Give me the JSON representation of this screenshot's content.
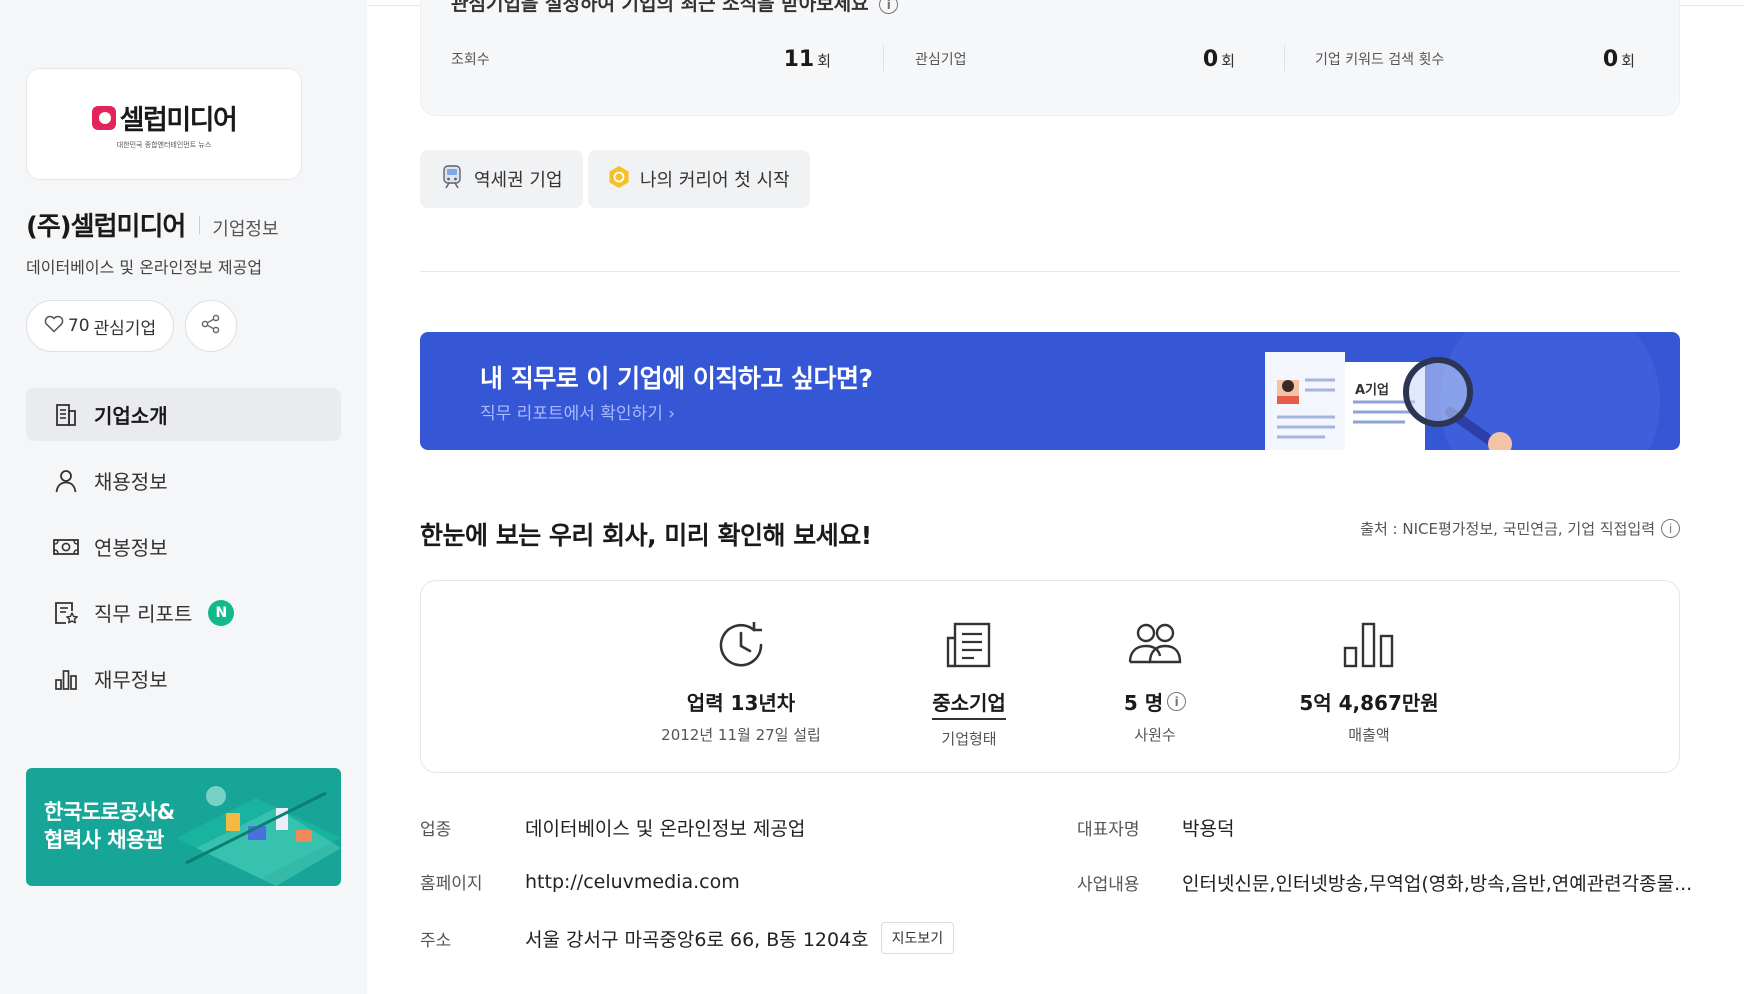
{
  "sidebar": {
    "logo": {
      "text": "셀럽미디어",
      "tagline": "대한민국 종합엔터테인먼트 뉴스"
    },
    "company_name": "(주)셀럽미디어",
    "company_tag": "기업정보",
    "industry": "데이터베이스 및 온라인정보 제공업",
    "favorite_count": "70",
    "favorite_label": "관심기업",
    "nav": [
      {
        "label": "기업소개",
        "icon": "building-icon",
        "active": true
      },
      {
        "label": "채용정보",
        "icon": "person-icon",
        "active": false
      },
      {
        "label": "연봉정보",
        "icon": "money-icon",
        "active": false
      },
      {
        "label": "직무 리포트",
        "icon": "report-icon",
        "active": false,
        "badge": "N"
      },
      {
        "label": "재무정보",
        "icon": "bar-chart-icon",
        "active": false
      }
    ],
    "promo": {
      "line1": "한국도로공사&",
      "line2": "협력사 채용관"
    }
  },
  "stats": {
    "title": "관심기업을 설정하여 기업의 최근 소식을 받아보세요",
    "items": [
      {
        "label": "조회수",
        "value": "11",
        "unit": "회"
      },
      {
        "label": "관심기업",
        "value": "0",
        "unit": "회"
      },
      {
        "label": "기업 키워드 검색 횟수",
        "value": "0",
        "unit": "회"
      }
    ]
  },
  "chips": [
    {
      "label": "역세권 기업",
      "icon": "train-icon"
    },
    {
      "label": "나의 커리어 첫 시작",
      "icon": "hexagon-badge-icon"
    }
  ],
  "banner": {
    "title": "내 직무로 이 기업에 이직하고 싶다면?",
    "link": "직무 리포트에서 확인하기",
    "doc_label": "A기업"
  },
  "summary": {
    "title": "한눈에 보는 우리 회사, 미리 확인해 보세요!",
    "source": "출처 : NICE평가정보, 국민연금, 기업 직접입력",
    "items": [
      {
        "value": "업력 13년차",
        "sub": "2012년 11월 27일 설립",
        "icon": "clock-icon"
      },
      {
        "value": "중소기업",
        "sub": "기업형태",
        "icon": "newspaper-icon"
      },
      {
        "value": "5 명",
        "sub": "사원수",
        "icon": "people-icon"
      },
      {
        "value": "5억 4,867만원",
        "sub": "매출액",
        "icon": "bar-chart-icon"
      }
    ]
  },
  "details": {
    "industry_label": "업종",
    "industry_value": "데이터베이스 및 온라인정보 제공업",
    "ceo_label": "대표자명",
    "ceo_value": "박용덕",
    "homepage_label": "홈페이지",
    "homepage_value": "http://celuvmedia.com",
    "business_label": "사업내용",
    "business_value": "인터넷신문,인터넷방송,무역업(영화,방속,음반,연예관련각종물...",
    "address_label": "주소",
    "address_value": "서울 강서구 마곡중앙6로 66, B동 1204호",
    "map_button": "지도보기"
  },
  "colors": {
    "accent_blue": "#3557d5",
    "badge_green": "#13b98a",
    "promo_teal": "#16a596",
    "logo_red": "#e2245a"
  }
}
